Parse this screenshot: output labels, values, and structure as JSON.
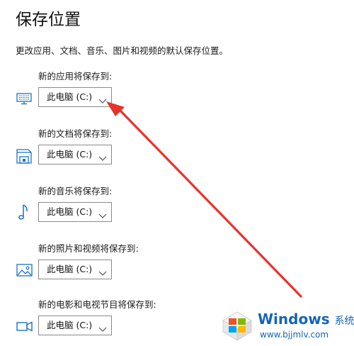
{
  "header": {
    "title": "保存位置",
    "description": "更改应用、文档、音乐、图片和视频的默认保存位置。"
  },
  "rows": [
    {
      "label": "新的应用将保存到:",
      "selected": "此电脑 (C:)",
      "icon": "monitor-icon"
    },
    {
      "label": "新的文档将保存到:",
      "selected": "此电脑 (C:)",
      "icon": "document-drive-icon"
    },
    {
      "label": "新的音乐将保存到:",
      "selected": "此电脑 (C:)",
      "icon": "music-note-icon"
    },
    {
      "label": "新的照片和视频将保存到:",
      "selected": "此电脑 (C:)",
      "icon": "picture-icon"
    },
    {
      "label": "新的电影和电视节目将保存到:",
      "selected": "此电脑 (C:)",
      "icon": "video-camera-icon"
    }
  ],
  "watermark": {
    "brand": "Windows",
    "brand_cn": "系统之家",
    "url": "www.bjjmlv.com"
  },
  "colors": {
    "icon_blue": "#1a73c7",
    "annotation_red": "#e8322e",
    "select_border": "#8a8a8a",
    "watermark_blue": "#1565b8"
  }
}
